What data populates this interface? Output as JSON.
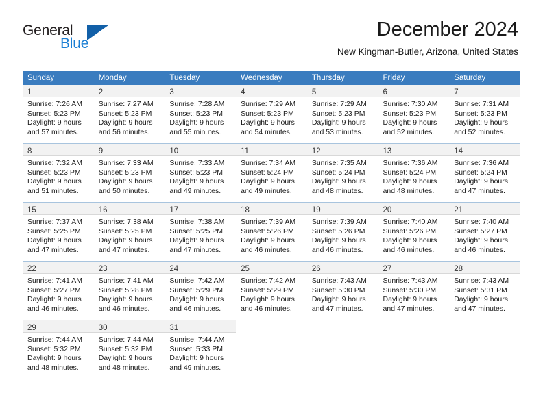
{
  "brand": {
    "name_part1": "General",
    "name_part2": "Blue",
    "mark": "triangle-logo"
  },
  "header": {
    "month_title": "December 2024",
    "location": "New Kingman-Butler, Arizona, United States"
  },
  "colors": {
    "header_blue": "#3a7cbf",
    "brand_blue": "#1b7fd4",
    "logo_blue": "#1260a8",
    "daynum_bg": "#f2f2f2",
    "row_separator": "#a8c4de",
    "cell_separator": "#d8d8d8"
  },
  "weekday_headers": [
    "Sunday",
    "Monday",
    "Tuesday",
    "Wednesday",
    "Thursday",
    "Friday",
    "Saturday"
  ],
  "weeks": [
    [
      {
        "day": "1",
        "sunrise": "Sunrise: 7:26 AM",
        "sunset": "Sunset: 5:23 PM",
        "daylight1": "Daylight: 9 hours",
        "daylight2": "and 57 minutes."
      },
      {
        "day": "2",
        "sunrise": "Sunrise: 7:27 AM",
        "sunset": "Sunset: 5:23 PM",
        "daylight1": "Daylight: 9 hours",
        "daylight2": "and 56 minutes."
      },
      {
        "day": "3",
        "sunrise": "Sunrise: 7:28 AM",
        "sunset": "Sunset: 5:23 PM",
        "daylight1": "Daylight: 9 hours",
        "daylight2": "and 55 minutes."
      },
      {
        "day": "4",
        "sunrise": "Sunrise: 7:29 AM",
        "sunset": "Sunset: 5:23 PM",
        "daylight1": "Daylight: 9 hours",
        "daylight2": "and 54 minutes."
      },
      {
        "day": "5",
        "sunrise": "Sunrise: 7:29 AM",
        "sunset": "Sunset: 5:23 PM",
        "daylight1": "Daylight: 9 hours",
        "daylight2": "and 53 minutes."
      },
      {
        "day": "6",
        "sunrise": "Sunrise: 7:30 AM",
        "sunset": "Sunset: 5:23 PM",
        "daylight1": "Daylight: 9 hours",
        "daylight2": "and 52 minutes."
      },
      {
        "day": "7",
        "sunrise": "Sunrise: 7:31 AM",
        "sunset": "Sunset: 5:23 PM",
        "daylight1": "Daylight: 9 hours",
        "daylight2": "and 52 minutes."
      }
    ],
    [
      {
        "day": "8",
        "sunrise": "Sunrise: 7:32 AM",
        "sunset": "Sunset: 5:23 PM",
        "daylight1": "Daylight: 9 hours",
        "daylight2": "and 51 minutes."
      },
      {
        "day": "9",
        "sunrise": "Sunrise: 7:33 AM",
        "sunset": "Sunset: 5:23 PM",
        "daylight1": "Daylight: 9 hours",
        "daylight2": "and 50 minutes."
      },
      {
        "day": "10",
        "sunrise": "Sunrise: 7:33 AM",
        "sunset": "Sunset: 5:23 PM",
        "daylight1": "Daylight: 9 hours",
        "daylight2": "and 49 minutes."
      },
      {
        "day": "11",
        "sunrise": "Sunrise: 7:34 AM",
        "sunset": "Sunset: 5:24 PM",
        "daylight1": "Daylight: 9 hours",
        "daylight2": "and 49 minutes."
      },
      {
        "day": "12",
        "sunrise": "Sunrise: 7:35 AM",
        "sunset": "Sunset: 5:24 PM",
        "daylight1": "Daylight: 9 hours",
        "daylight2": "and 48 minutes."
      },
      {
        "day": "13",
        "sunrise": "Sunrise: 7:36 AM",
        "sunset": "Sunset: 5:24 PM",
        "daylight1": "Daylight: 9 hours",
        "daylight2": "and 48 minutes."
      },
      {
        "day": "14",
        "sunrise": "Sunrise: 7:36 AM",
        "sunset": "Sunset: 5:24 PM",
        "daylight1": "Daylight: 9 hours",
        "daylight2": "and 47 minutes."
      }
    ],
    [
      {
        "day": "15",
        "sunrise": "Sunrise: 7:37 AM",
        "sunset": "Sunset: 5:25 PM",
        "daylight1": "Daylight: 9 hours",
        "daylight2": "and 47 minutes."
      },
      {
        "day": "16",
        "sunrise": "Sunrise: 7:38 AM",
        "sunset": "Sunset: 5:25 PM",
        "daylight1": "Daylight: 9 hours",
        "daylight2": "and 47 minutes."
      },
      {
        "day": "17",
        "sunrise": "Sunrise: 7:38 AM",
        "sunset": "Sunset: 5:25 PM",
        "daylight1": "Daylight: 9 hours",
        "daylight2": "and 47 minutes."
      },
      {
        "day": "18",
        "sunrise": "Sunrise: 7:39 AM",
        "sunset": "Sunset: 5:26 PM",
        "daylight1": "Daylight: 9 hours",
        "daylight2": "and 46 minutes."
      },
      {
        "day": "19",
        "sunrise": "Sunrise: 7:39 AM",
        "sunset": "Sunset: 5:26 PM",
        "daylight1": "Daylight: 9 hours",
        "daylight2": "and 46 minutes."
      },
      {
        "day": "20",
        "sunrise": "Sunrise: 7:40 AM",
        "sunset": "Sunset: 5:26 PM",
        "daylight1": "Daylight: 9 hours",
        "daylight2": "and 46 minutes."
      },
      {
        "day": "21",
        "sunrise": "Sunrise: 7:40 AM",
        "sunset": "Sunset: 5:27 PM",
        "daylight1": "Daylight: 9 hours",
        "daylight2": "and 46 minutes."
      }
    ],
    [
      {
        "day": "22",
        "sunrise": "Sunrise: 7:41 AM",
        "sunset": "Sunset: 5:27 PM",
        "daylight1": "Daylight: 9 hours",
        "daylight2": "and 46 minutes."
      },
      {
        "day": "23",
        "sunrise": "Sunrise: 7:41 AM",
        "sunset": "Sunset: 5:28 PM",
        "daylight1": "Daylight: 9 hours",
        "daylight2": "and 46 minutes."
      },
      {
        "day": "24",
        "sunrise": "Sunrise: 7:42 AM",
        "sunset": "Sunset: 5:29 PM",
        "daylight1": "Daylight: 9 hours",
        "daylight2": "and 46 minutes."
      },
      {
        "day": "25",
        "sunrise": "Sunrise: 7:42 AM",
        "sunset": "Sunset: 5:29 PM",
        "daylight1": "Daylight: 9 hours",
        "daylight2": "and 46 minutes."
      },
      {
        "day": "26",
        "sunrise": "Sunrise: 7:43 AM",
        "sunset": "Sunset: 5:30 PM",
        "daylight1": "Daylight: 9 hours",
        "daylight2": "and 47 minutes."
      },
      {
        "day": "27",
        "sunrise": "Sunrise: 7:43 AM",
        "sunset": "Sunset: 5:30 PM",
        "daylight1": "Daylight: 9 hours",
        "daylight2": "and 47 minutes."
      },
      {
        "day": "28",
        "sunrise": "Sunrise: 7:43 AM",
        "sunset": "Sunset: 5:31 PM",
        "daylight1": "Daylight: 9 hours",
        "daylight2": "and 47 minutes."
      }
    ],
    [
      {
        "day": "29",
        "sunrise": "Sunrise: 7:44 AM",
        "sunset": "Sunset: 5:32 PM",
        "daylight1": "Daylight: 9 hours",
        "daylight2": "and 48 minutes."
      },
      {
        "day": "30",
        "sunrise": "Sunrise: 7:44 AM",
        "sunset": "Sunset: 5:32 PM",
        "daylight1": "Daylight: 9 hours",
        "daylight2": "and 48 minutes."
      },
      {
        "day": "31",
        "sunrise": "Sunrise: 7:44 AM",
        "sunset": "Sunset: 5:33 PM",
        "daylight1": "Daylight: 9 hours",
        "daylight2": "and 49 minutes."
      },
      {
        "day": "",
        "sunrise": "",
        "sunset": "",
        "daylight1": "",
        "daylight2": ""
      },
      {
        "day": "",
        "sunrise": "",
        "sunset": "",
        "daylight1": "",
        "daylight2": ""
      },
      {
        "day": "",
        "sunrise": "",
        "sunset": "",
        "daylight1": "",
        "daylight2": ""
      },
      {
        "day": "",
        "sunrise": "",
        "sunset": "",
        "daylight1": "",
        "daylight2": ""
      }
    ]
  ]
}
